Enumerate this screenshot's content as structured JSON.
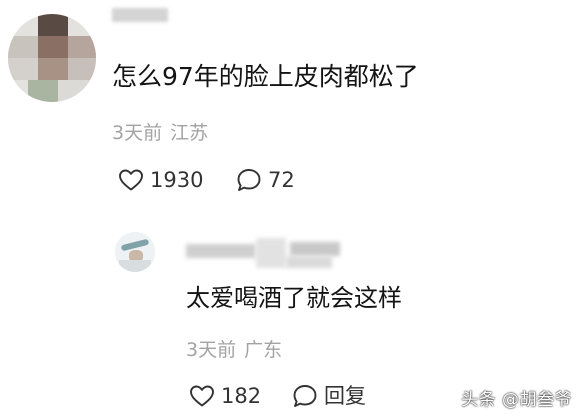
{
  "comment": {
    "text": "怎么97年的脸上皮肉都松了",
    "time": "3天前",
    "location": "江苏",
    "likes": "1930",
    "replies": "72"
  },
  "reply": {
    "text": "太爱喝酒了就会这样",
    "time": "3天前",
    "location": "广东",
    "likes": "182",
    "reply_label": "回复"
  },
  "watermark": "头条 @胡叁爷",
  "icons": {
    "like": "heart-outline-icon",
    "comment": "speech-bubble-icon"
  },
  "colors": {
    "text": "#141414",
    "meta": "#a3a3a3",
    "action": "#333333"
  }
}
